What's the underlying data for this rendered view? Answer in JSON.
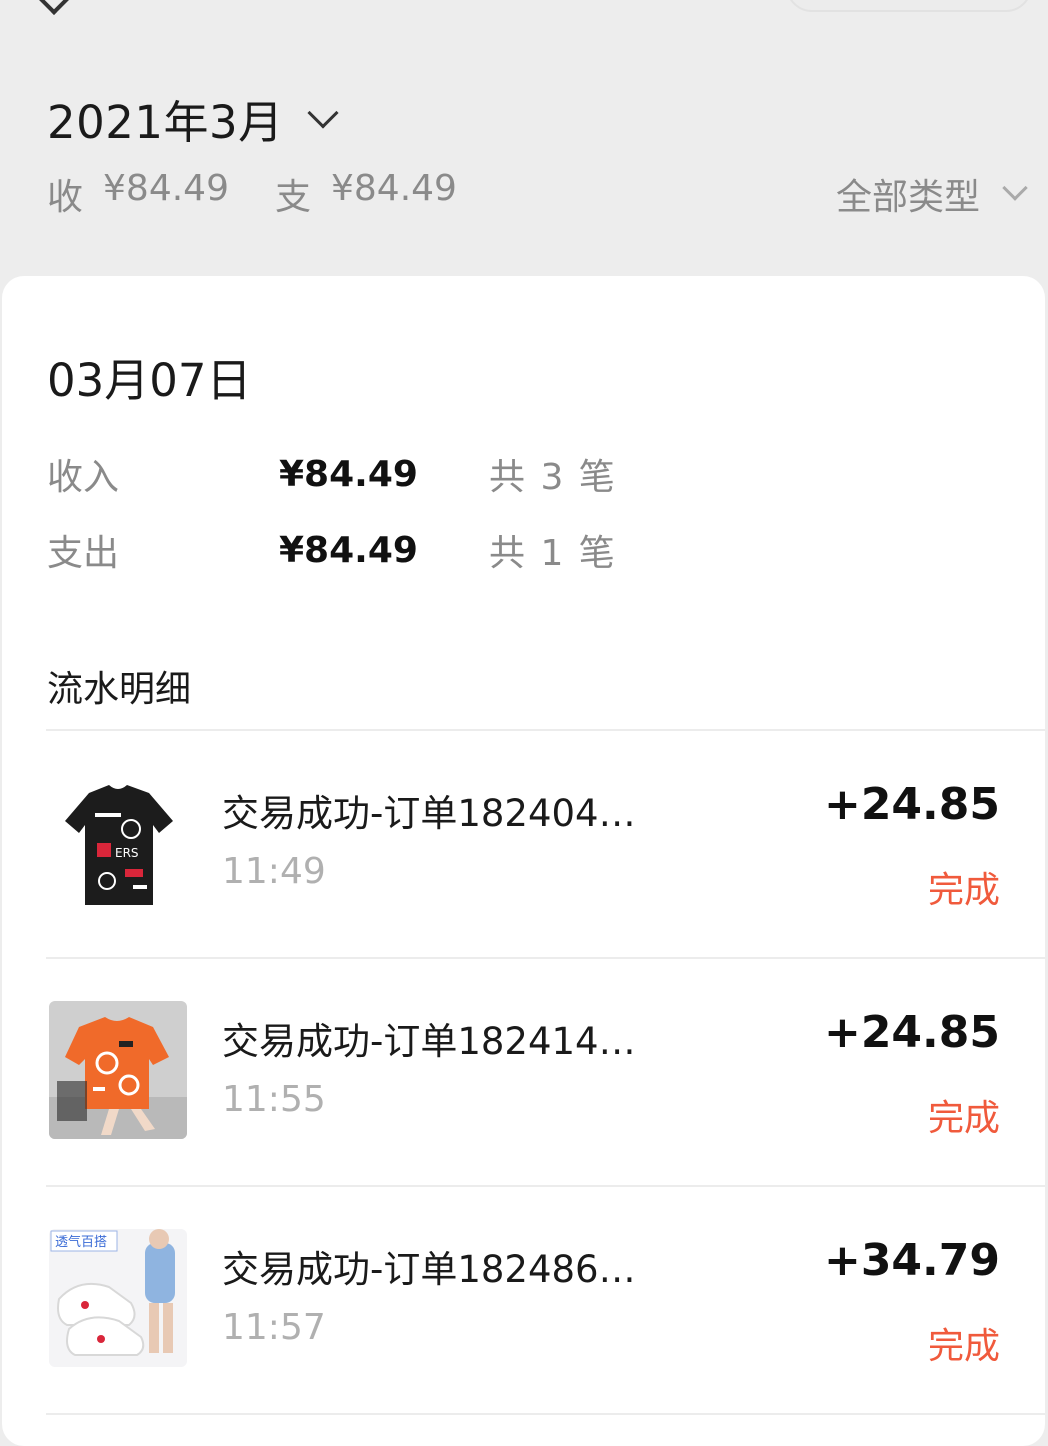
{
  "header": {
    "month": "2021年3月",
    "income_label": "收",
    "income_value": "¥84.49",
    "expense_label": "支",
    "expense_value": "¥84.49",
    "filter_label": "全部类型"
  },
  "day": {
    "date": "03月07日",
    "stats": [
      {
        "label": "收入",
        "amount": "¥84.49",
        "count": "共 3 笔"
      },
      {
        "label": "支出",
        "amount": "¥84.49",
        "count": "共 1 笔"
      }
    ]
  },
  "section_title": "流水明细",
  "transactions": [
    {
      "title": "交易成功-订单182404…",
      "time": "11:49",
      "amount": "+24.85",
      "status": "完成",
      "thumb_icon": "black-tshirt-dress-photo"
    },
    {
      "title": "交易成功-订单182414…",
      "time": "11:55",
      "amount": "+24.85",
      "status": "完成",
      "thumb_icon": "orange-tshirt-photo"
    },
    {
      "title": "交易成功-订单182486…",
      "time": "11:57",
      "amount": "+34.79",
      "status": "完成",
      "thumb_icon": "white-sneakers-photo",
      "thumb_badge": "透气百搭"
    }
  ],
  "colors": {
    "status": "#f05a3c",
    "muted": "#8a8a8a",
    "background": "#ededed"
  }
}
